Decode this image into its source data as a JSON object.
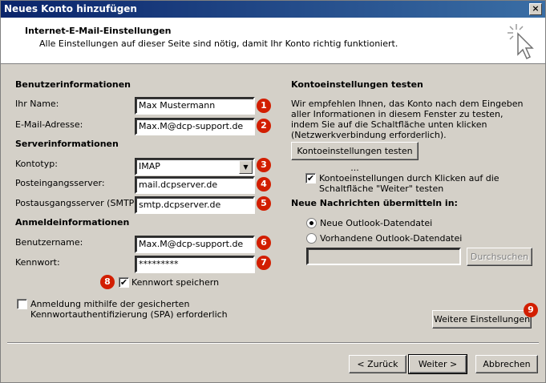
{
  "window": {
    "title": "Neues Konto hinzufügen",
    "close_label": "×"
  },
  "header": {
    "title": "Internet-E-Mail-Einstellungen",
    "subtitle": "Alle Einstellungen auf dieser Seite sind nötig, damit Ihr Konto richtig funktioniert."
  },
  "user_info": {
    "heading": "Benutzerinformationen",
    "name_label": "Ihr Name:",
    "name_value": "Max Mustermann",
    "email_label": "E-Mail-Adresse:",
    "email_value": "Max.M@dcp-support.de"
  },
  "server_info": {
    "heading": "Serverinformationen",
    "type_label": "Kontotyp:",
    "type_value": "IMAP",
    "incoming_label": "Posteingangsserver:",
    "incoming_value": "mail.dcpserver.de",
    "outgoing_label": "Postausgangsserver (SMTP):",
    "outgoing_value": "smtp.dcpserver.de"
  },
  "login_info": {
    "heading": "Anmeldeinformationen",
    "user_label": "Benutzername:",
    "user_value": "Max.M@dcp-support.de",
    "password_label": "Kennwort:",
    "password_value": "*********",
    "save_password_label": "Kennwort speichern",
    "spa_label": "Anmeldung mithilfe der gesicherten Kennwortauthentifizierung (SPA) erforderlich"
  },
  "test": {
    "heading": "Kontoeinstellungen testen",
    "description": "Wir empfehlen Ihnen, das Konto nach dem Eingeben aller Informationen in diesem Fenster zu testen, indem Sie auf die Schaltfläche unten klicken (Netzwerkverbindung erforderlich).",
    "button_label": "Kontoeinstellungen testen ...",
    "auto_test_label": "Kontoeinstellungen durch Klicken auf die Schaltfläche \"Weiter\" testen"
  },
  "deliver": {
    "heading": "Neue Nachrichten übermitteln in:",
    "option_new": "Neue Outlook-Datendatei",
    "option_existing": "Vorhandene Outlook-Datendatei",
    "browse_label": "Durchsuchen"
  },
  "more_settings_label": "Weitere Einstellungen",
  "footer": {
    "back_label": "< Zurück",
    "next_label": "Weiter >",
    "cancel_label": "Abbrechen"
  },
  "badges": [
    "1",
    "2",
    "3",
    "4",
    "5",
    "6",
    "7",
    "8",
    "9"
  ],
  "colors": {
    "badge": "#d21e00",
    "titlebar": "#0a246a"
  }
}
